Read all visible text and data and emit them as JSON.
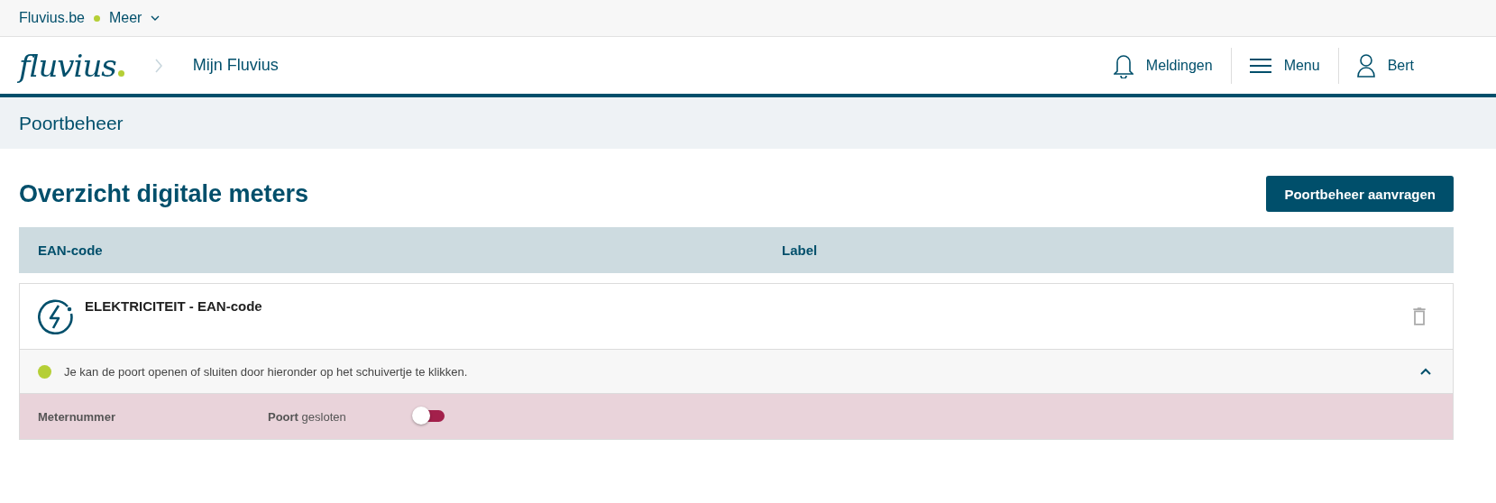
{
  "top_bar": {
    "site_link": "Fluvius.be",
    "more_menu": "Meer"
  },
  "header": {
    "logo": "fluvius",
    "breadcrumb": "Mijn Fluvius",
    "actions": [
      {
        "kind": "bell",
        "label": "Meldingen"
      },
      {
        "kind": "menu",
        "label": "Menu"
      },
      {
        "kind": "user",
        "label": "Bert"
      }
    ]
  },
  "section_bar": {
    "title": "Poortbeheer"
  },
  "page": {
    "title": "Overzicht digitale meters",
    "request_button": "Poortbeheer aanvragen"
  },
  "table": {
    "columns": [
      "EAN-code",
      "Label"
    ],
    "rows": [
      {
        "title": "ELEKTRICITEIT - EAN-code",
        "expanded": true,
        "status": {
          "color": "#b5cf36",
          "text": "Je kan de poort openen of sluiten door hieronder op het schuivertje te klikken."
        },
        "meter_label": "Meternummer",
        "port_label": "**Poort** gesloten",
        "port_open": false
      }
    ]
  }
}
